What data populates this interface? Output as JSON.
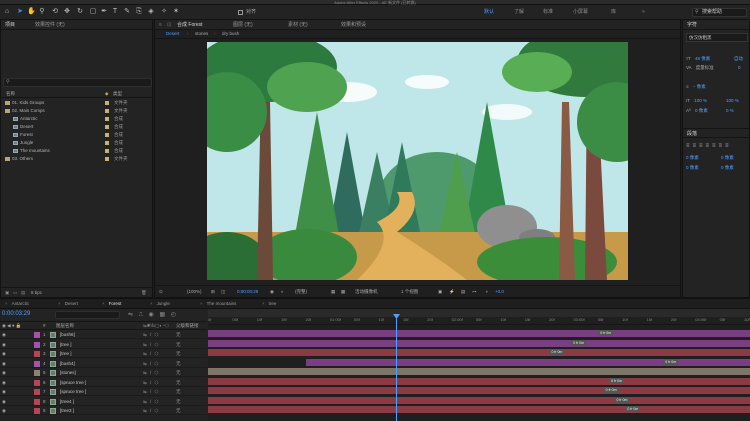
{
  "app": {
    "window_title": "Adobe After Effects 2020 - AE 新文件 (已转换)"
  },
  "toolbar": {
    "tools": [
      "home-icon",
      "select-icon",
      "hand-icon",
      "zoom-icon",
      "orbit-icon",
      "move-icon",
      "rotate-icon",
      "rect-icon",
      "pen-icon",
      "text-icon",
      "brush-icon",
      "clone-icon",
      "eraser-icon",
      "roto-icon",
      "puppet-icon"
    ],
    "snap_label": "对齐",
    "workspaces": [
      "默认",
      "了解",
      "标准",
      "小屏幕",
      "库",
      "»"
    ],
    "active_workspace": "默认",
    "search_placeholder": "搜索帮助"
  },
  "project_panel": {
    "tabs": [
      "项目",
      "效果控件 (无)"
    ],
    "search_value": "",
    "col_name": "名称",
    "col_type": "类型",
    "items": [
      {
        "name": "01. Kids Groups",
        "type": "文件夹",
        "kind": "folder",
        "indent": 0,
        "swatch": "#c9b36a"
      },
      {
        "name": "02. Main Comps",
        "type": "文件夹",
        "kind": "folder",
        "indent": 0,
        "swatch": "#c9b36a"
      },
      {
        "name": "Antarctic",
        "type": "合成",
        "kind": "comp",
        "indent": 1,
        "swatch": "#c9b36a"
      },
      {
        "name": "Desert",
        "type": "合成",
        "kind": "comp",
        "indent": 1,
        "swatch": "#c9b36a"
      },
      {
        "name": "Forest",
        "type": "合成",
        "kind": "comp",
        "indent": 1,
        "swatch": "#c9b36a"
      },
      {
        "name": "Jungle",
        "type": "合成",
        "kind": "comp",
        "indent": 1,
        "swatch": "#c9b36a"
      },
      {
        "name": "The mountains",
        "type": "合成",
        "kind": "comp",
        "indent": 1,
        "swatch": "#c9b36a"
      },
      {
        "name": "03. Others",
        "type": "文件夹",
        "kind": "folder",
        "indent": 0,
        "swatch": "#c9b36a"
      }
    ],
    "bpc": "8 bpc"
  },
  "viewer": {
    "tabs": [
      "合成 Forest",
      "图层 (无)",
      "素材 (无)",
      "效果和预设"
    ],
    "flow": [
      "Desert",
      "stones",
      "dry bush"
    ],
    "active_flow": "Desert",
    "zoom": "(100%)",
    "timecode": "0:00:03:29",
    "resolution": "(完整)",
    "camera": "活动摄像机",
    "views": "1 个视图",
    "exposure": "+0.0"
  },
  "right_panel": {
    "tab_char": "字符",
    "font": "仿汉仿粗黑",
    "size": "48 像素",
    "leading": "自动",
    "tracking_label": "度量标准",
    "tracking_value": "0",
    "stroke": "– 像素",
    "scale_v": "100 %",
    "scale_h": "100 %",
    "baseline": "0 像素",
    "tsume": "0 %",
    "tab_para": "段落",
    "indent_left": "0 像素",
    "indent_right": "0 像素",
    "space_before": "0 像素",
    "space_after": "0 像素"
  },
  "timeline": {
    "tabs": [
      "Antarctic",
      "Desert",
      "Forest",
      "Jungle",
      "The mountains",
      "tree"
    ],
    "active_tab": "Forest",
    "timecode": "0:00:03:29",
    "col_layer_name": "图层名称",
    "col_parent": "父级和链接",
    "ruler": [
      "0f",
      "05f",
      "10f",
      "15f",
      "20f",
      "01:00f",
      "05f",
      "10f",
      "15f",
      "20f",
      "02:00f",
      "05f",
      "10f",
      "15f",
      "20f",
      "03:00f",
      "05f",
      "10f",
      "15f",
      "20f",
      "04:00f",
      "05f",
      "10f"
    ],
    "layers": [
      {
        "num": "1",
        "name": "[bush6]",
        "label": "#a453a8",
        "parent": "无",
        "bar": "#7a3e83",
        "bar_start": 0.0,
        "key": "0 fr 0m",
        "key_pos": 0.72
      },
      {
        "num": "2",
        "name": "[tree ]",
        "label": "#a453a8",
        "parent": "无",
        "bar": "#7a3e83",
        "bar_start": 0.0,
        "key": "0 fr 0m",
        "key_pos": 0.67
      },
      {
        "num": "3",
        "name": "[tree ]",
        "label": "#b6455a",
        "parent": "无",
        "bar": "#8c3a44",
        "bar_start": 0.0,
        "key": "0 fr 0m",
        "key_pos": 0.63
      },
      {
        "num": "4",
        "name": "[bush4]",
        "label": "#a453a8",
        "parent": "无",
        "bar": "#7a3e83",
        "bar_start": 0.18,
        "key": "0 fr 0m",
        "key_pos": 0.84
      },
      {
        "num": "5",
        "name": "[stones]",
        "label": "#8b8272",
        "parent": "无",
        "bar": "#7d7668",
        "bar_start": 0.0,
        "key": "",
        "key_pos": 0
      },
      {
        "num": "6",
        "name": "[spruce tree ]",
        "label": "#b6455a",
        "parent": "无",
        "bar": "#8c3a44",
        "bar_start": 0.0,
        "key": "0 fr 0m",
        "key_pos": 0.74
      },
      {
        "num": "7",
        "name": "[spruce tree ]",
        "label": "#b6455a",
        "parent": "无",
        "bar": "#8c3a44",
        "bar_start": 0.0,
        "key": "0 fr 0m",
        "key_pos": 0.73
      },
      {
        "num": "8",
        "name": "[tree4 ]",
        "label": "#b6455a",
        "parent": "无",
        "bar": "#8c3a44",
        "bar_start": 0.0,
        "key": "0 fr 0m",
        "key_pos": 0.75
      },
      {
        "num": "9",
        "name": "[tree3 ]",
        "label": "#b6455a",
        "parent": "无",
        "bar": "#8c3a44",
        "bar_start": 0.0,
        "key": "0 fr 0m",
        "key_pos": 0.77
      }
    ]
  },
  "colors": {
    "accent": "#3d8bfd",
    "timecode": "#4ea0ff",
    "panel": "#232323",
    "bg": "#1d1d1d"
  }
}
